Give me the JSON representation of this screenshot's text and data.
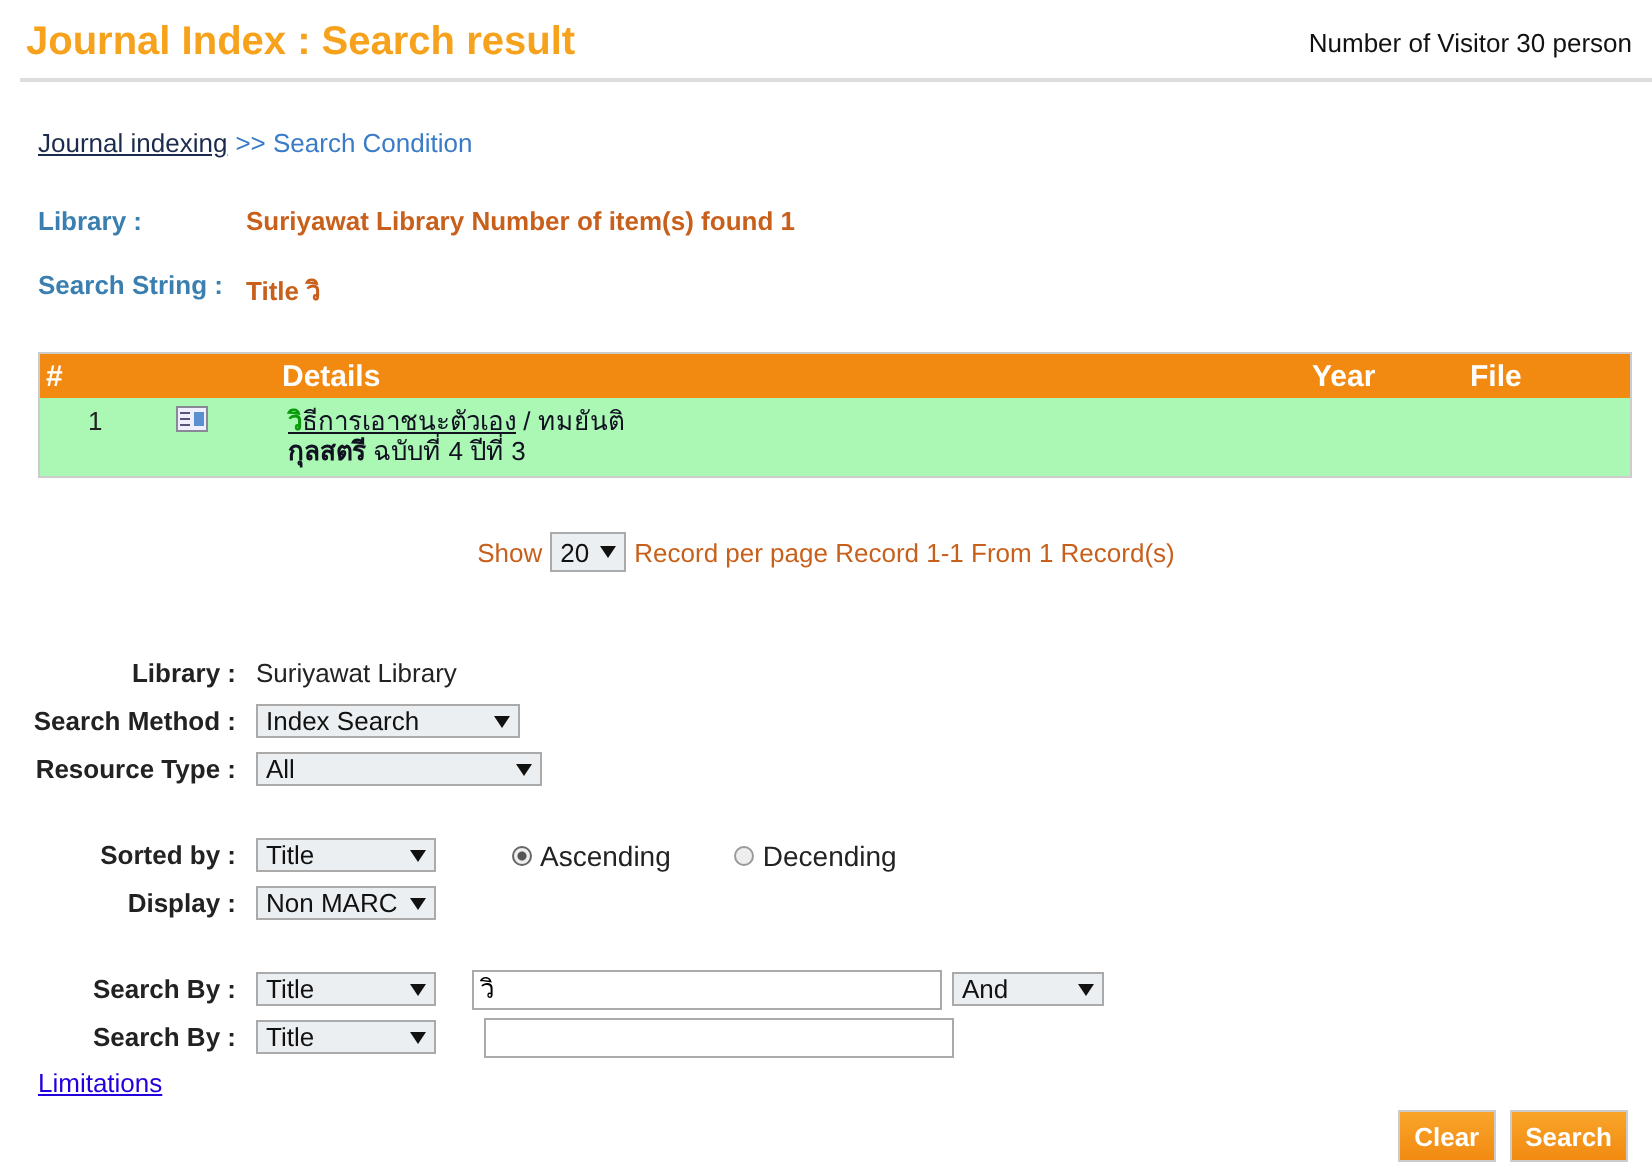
{
  "header": {
    "title": "Journal Index : Search result",
    "visitors": "Number of Visitor 30 person"
  },
  "breadcrumb": {
    "link": "Journal indexing",
    "rest": ">> Search Condition"
  },
  "summary": [
    {
      "label": "Library :",
      "value": "Suriyawat Library Number of item(s) found 1"
    },
    {
      "label": "Search String :",
      "value": "Title วิ"
    }
  ],
  "table": {
    "columns": [
      "#",
      "Details",
      "Year",
      "File"
    ],
    "rows": [
      {
        "number": "1",
        "title_match": "วิ",
        "title_rest": "ธีการเอาชนะตัวเอง",
        "author": "/ ทมยันติ",
        "source": "**กุลสตรี** ฉบับที่ 4 ปีที่ 3"
      }
    ]
  },
  "paging": {
    "show": "Show",
    "per_page": "20",
    "text": "Record per page Record 1-1 From 1 Record(s)"
  },
  "form": {
    "library_label": "Library :",
    "library_value": "Suriyawat Library",
    "method_label": "Search Method :",
    "method": "Index Search",
    "type_label": "Resource Type :",
    "type": "All",
    "sort_label": "Sorted by :",
    "sort": "Title",
    "order": [
      {
        "label": "Ascending",
        "selected": true
      },
      {
        "label": "Decending",
        "selected": false
      }
    ],
    "display_label": "Display :",
    "display": "Non MARC",
    "search_by": [
      {
        "label": "Search By :",
        "field": "Title",
        "value": "วิ",
        "operator": "And"
      },
      {
        "label": "Search By :",
        "field": "Title"
      }
    ],
    "limitations": "Limitations"
  },
  "buttons": [
    "Clear",
    "Search"
  ]
}
